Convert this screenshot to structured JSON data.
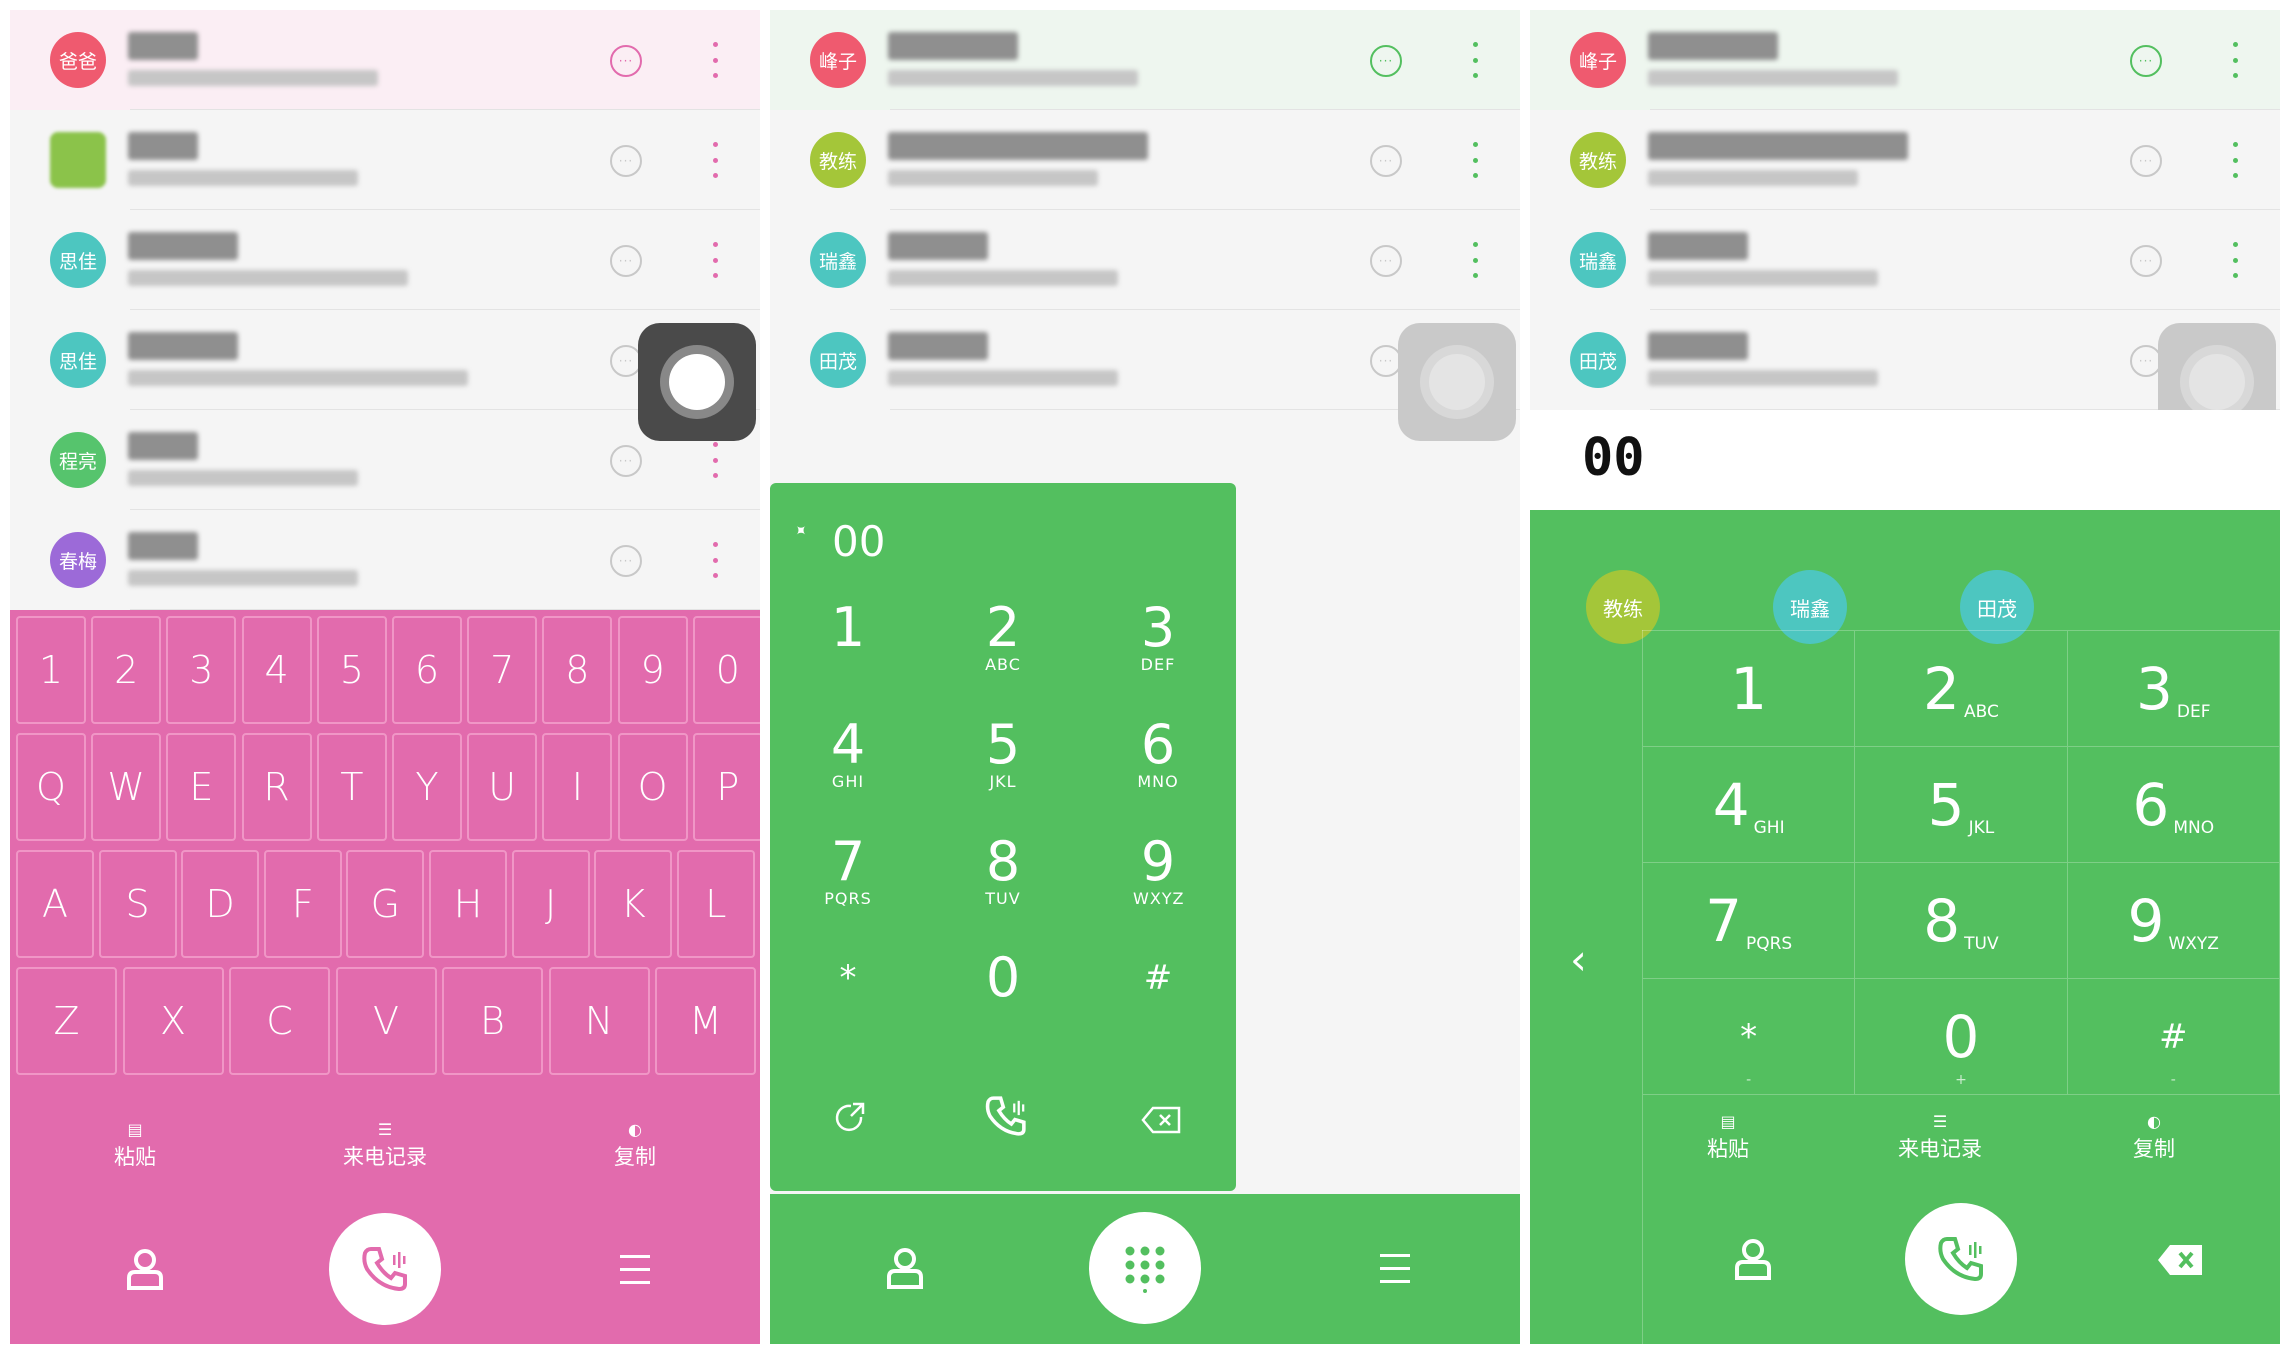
{
  "panel1": {
    "contacts": [
      {
        "avatar_text": "爸爸",
        "color": "#ef5a6f"
      },
      {
        "avatar_text": "",
        "color": "#8bc34a"
      },
      {
        "avatar_text": "思佳",
        "color": "#4dc6c0"
      },
      {
        "avatar_text": "思佳",
        "color": "#4dc6c0"
      },
      {
        "avatar_text": "程亮",
        "color": "#56c46d"
      },
      {
        "avatar_text": "春梅",
        "color": "#9c6ad8"
      }
    ],
    "accent": "#e26bad",
    "keyboard": {
      "row1": [
        "1",
        "2",
        "3",
        "4",
        "5",
        "6",
        "7",
        "8",
        "9",
        "0"
      ],
      "row2": [
        "Q",
        "W",
        "E",
        "R",
        "T",
        "Y",
        "U",
        "I",
        "O",
        "P"
      ],
      "row3": [
        "A",
        "S",
        "D",
        "F",
        "G",
        "H",
        "J",
        "K",
        "L"
      ],
      "row4": [
        "Z",
        "X",
        "C",
        "V",
        "B",
        "N",
        "M"
      ]
    },
    "tools": {
      "paste": "粘贴",
      "call_log": "来电记录",
      "copy": "复制"
    }
  },
  "panel2": {
    "contacts": [
      {
        "avatar_text": "峰子",
        "color": "#ef5a6f"
      },
      {
        "avatar_text": "教练",
        "color": "#a4c639"
      },
      {
        "avatar_text": "瑞鑫",
        "color": "#4dc6c0"
      },
      {
        "avatar_text": "田茂",
        "color": "#4dc6c0"
      }
    ],
    "accent": "#53bf5f",
    "display": "00",
    "keys": [
      {
        "n": "1",
        "l": ""
      },
      {
        "n": "2",
        "l": "ABC"
      },
      {
        "n": "3",
        "l": "DEF"
      },
      {
        "n": "4",
        "l": "GHI"
      },
      {
        "n": "5",
        "l": "JKL"
      },
      {
        "n": "6",
        "l": "MNO"
      },
      {
        "n": "7",
        "l": "PQRS"
      },
      {
        "n": "8",
        "l": "TUV"
      },
      {
        "n": "9",
        "l": "WXYZ"
      },
      {
        "n": "*",
        "l": ""
      },
      {
        "n": "0",
        "l": ""
      },
      {
        "n": "#",
        "l": ""
      }
    ]
  },
  "panel3": {
    "contacts": [
      {
        "avatar_text": "峰子",
        "color": "#ef5a6f"
      },
      {
        "avatar_text": "教练",
        "color": "#a4c639"
      },
      {
        "avatar_text": "瑞鑫",
        "color": "#4dc6c0"
      },
      {
        "avatar_text": "田茂",
        "color": "#4dc6c0"
      }
    ],
    "display": "00",
    "chips": [
      {
        "text": "教练",
        "color": "#a4c639"
      },
      {
        "text": "瑞鑫",
        "color": "#4dc6c0"
      },
      {
        "text": "田茂",
        "color": "#4dc6c0"
      }
    ],
    "keys": [
      {
        "n": "1",
        "l": "",
        "s": ""
      },
      {
        "n": "2",
        "l": "ABC",
        "s": ""
      },
      {
        "n": "3",
        "l": "DEF",
        "s": ""
      },
      {
        "n": "4",
        "l": "GHI",
        "s": ""
      },
      {
        "n": "5",
        "l": "JKL",
        "s": ""
      },
      {
        "n": "6",
        "l": "MNO",
        "s": ""
      },
      {
        "n": "7",
        "l": "PQRS",
        "s": ""
      },
      {
        "n": "8",
        "l": "TUV",
        "s": ""
      },
      {
        "n": "9",
        "l": "WXYZ",
        "s": ""
      },
      {
        "n": "*",
        "l": "",
        "s": "-"
      },
      {
        "n": "0",
        "l": "",
        "s": "+"
      },
      {
        "n": "#",
        "l": "",
        "s": "-"
      }
    ],
    "tools": {
      "paste": "粘贴",
      "call_log": "来电记录",
      "copy": "复制"
    }
  }
}
